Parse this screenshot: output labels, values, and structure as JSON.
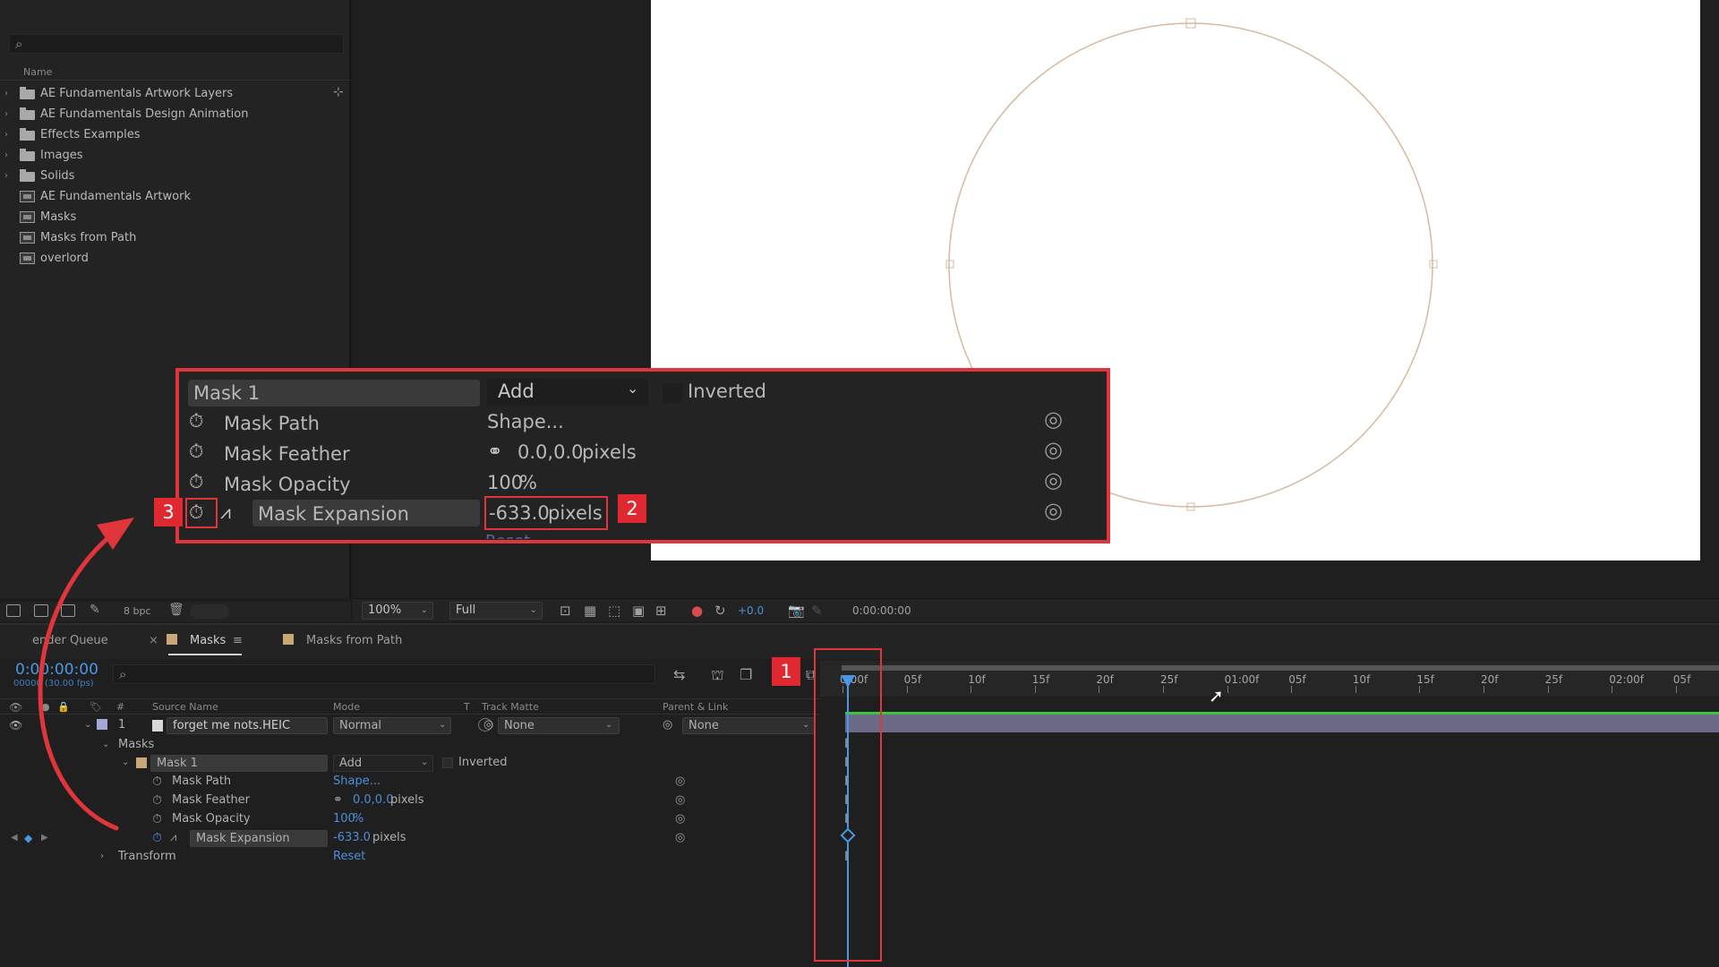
{
  "project": {
    "search_icon": "search-icon",
    "column_name": "Name",
    "items": [
      {
        "type": "folder",
        "label": "AE Fundamentals Artwork Layers"
      },
      {
        "type": "folder",
        "label": "AE Fundamentals Design Animation"
      },
      {
        "type": "folder",
        "label": "Effects Examples"
      },
      {
        "type": "folder",
        "label": "Images"
      },
      {
        "type": "folder",
        "label": "Solids"
      },
      {
        "type": "comp",
        "label": "AE Fundamentals Artwork"
      },
      {
        "type": "comp",
        "label": "Masks"
      },
      {
        "type": "comp",
        "label": "Masks from Path"
      },
      {
        "type": "comp",
        "label": "overlord"
      }
    ],
    "bpc": "8 bpc"
  },
  "viewer": {
    "zoom": "100%",
    "resolution": "Full",
    "exposure": "+0.0",
    "time": "0:00:00:00"
  },
  "timeline": {
    "tabs": [
      "ender Queue",
      "Masks",
      "Masks from Path"
    ],
    "active_tab": "Masks",
    "timecode": "0:00:00:00",
    "fps": "00000 (30.00 fps)",
    "columns": {
      "source": "Source Name",
      "mode": "Mode",
      "t": "T",
      "track_matte": "Track Matte",
      "parent": "Parent & Link",
      "hash": "#"
    },
    "layer": {
      "number": "1",
      "name": "forget me nots.HEIC",
      "mode": "Normal",
      "track_matte": "None",
      "parent": "None"
    },
    "masks_group": "Masks",
    "mask": {
      "name": "Mask 1",
      "mode": "Add",
      "inverted": "Inverted"
    },
    "properties": [
      {
        "name": "Mask Path",
        "value": "Shape..."
      },
      {
        "name": "Mask Feather",
        "value": "0.0,0.0",
        "unit": "pixels"
      },
      {
        "name": "Mask Opacity",
        "value": "100",
        "unit": "%"
      },
      {
        "name": "Mask Expansion",
        "value": "-633.0",
        "unit": "pixels"
      }
    ],
    "transform": {
      "label": "Transform",
      "value": "Reset"
    },
    "ruler_ticks": [
      "0:00f",
      "05f",
      "10f",
      "15f",
      "20f",
      "25f",
      "01:00f",
      "05f",
      "10f",
      "15f",
      "20f",
      "25f",
      "02:00f",
      "05f"
    ]
  },
  "callout": {
    "mask_name": "Mask 1",
    "mode": "Add",
    "inverted": "Inverted",
    "rows": [
      {
        "name": "Mask Path",
        "value": "Shape..."
      },
      {
        "name": "Mask Feather",
        "value": "0.0,0.0",
        "unit": "pixels"
      },
      {
        "name": "Mask Opacity",
        "value": "100",
        "unit": "%"
      },
      {
        "name": "Mask Expansion",
        "value": "-633.0",
        "unit": "pixels"
      }
    ],
    "reset_partial": "Reset",
    "badges": [
      "1",
      "2",
      "3"
    ]
  },
  "colors": {
    "annotation_red": "#e0353b",
    "ae_blue": "#4c96e8",
    "mask_outline": "#d8b8a0"
  }
}
